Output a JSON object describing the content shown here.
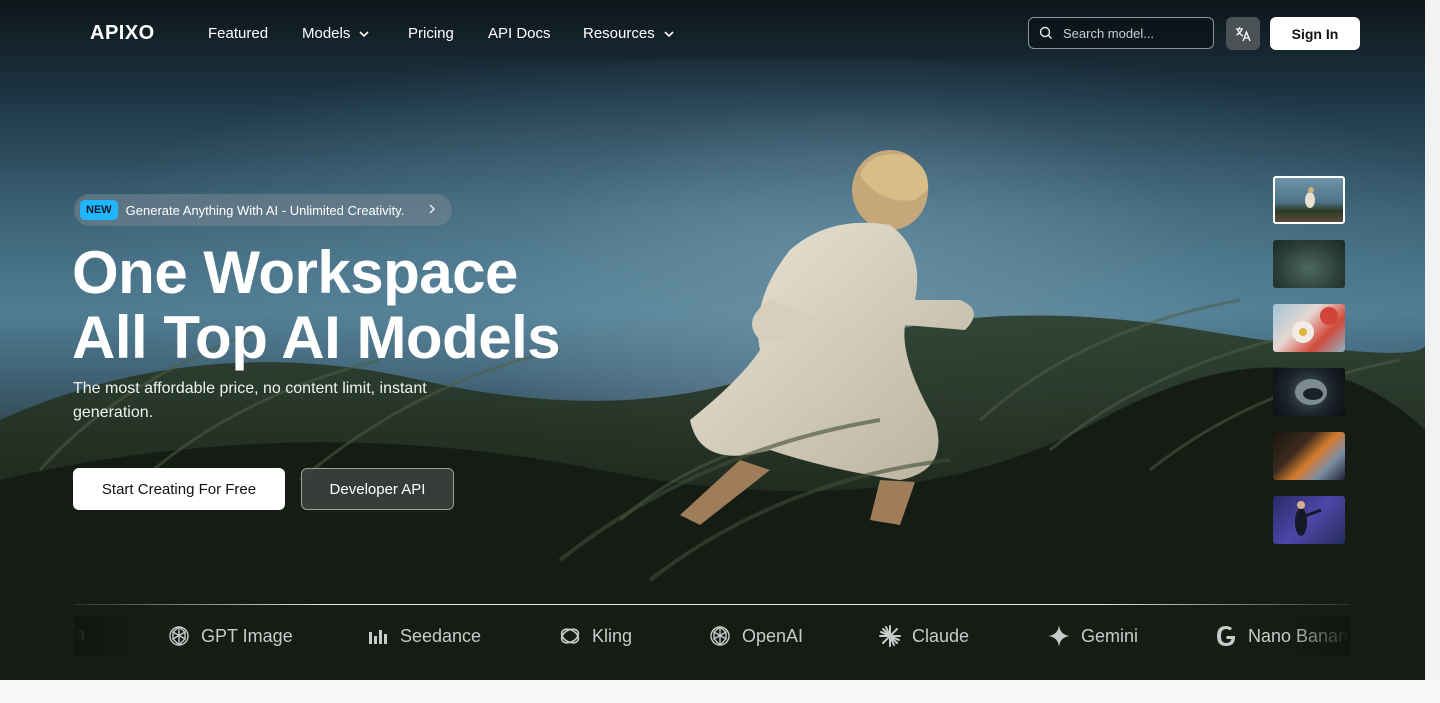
{
  "nav": {
    "logo": "APIXO",
    "items": [
      {
        "label": "Featured",
        "dropdown": false
      },
      {
        "label": "Models",
        "dropdown": true
      },
      {
        "label": "Pricing",
        "dropdown": false
      },
      {
        "label": "API Docs",
        "dropdown": false
      },
      {
        "label": "Resources",
        "dropdown": true
      }
    ],
    "search_placeholder": "Search model...",
    "language_icon": "translate-icon",
    "sign_in": "Sign In"
  },
  "hero": {
    "badge_tag": "NEW",
    "badge_text": "Generate Anything With AI - Unlimited Creativity.",
    "headline_line1": "One Workspace",
    "headline_line2": "All Top AI Models",
    "subtitle": "The most affordable price, no content limit, instant generation.",
    "primary_cta": "Start Creating For Free",
    "secondary_cta": "Developer API"
  },
  "thumbnails": [
    {
      "name": "runner-thumbnail",
      "active": true
    },
    {
      "name": "forest-thumbnail",
      "active": false
    },
    {
      "name": "flowers-thumbnail",
      "active": false
    },
    {
      "name": "helmet-thumbnail",
      "active": false
    },
    {
      "name": "fire-thumbnail",
      "active": false
    },
    {
      "name": "dancer-thumbnail",
      "active": false
    }
  ],
  "brands": [
    {
      "label": "na",
      "icon": "partial-icon"
    },
    {
      "label": "GPT Image",
      "icon": "openai-icon"
    },
    {
      "label": "Seedance",
      "icon": "bars-icon"
    },
    {
      "label": "Kling",
      "icon": "kling-icon"
    },
    {
      "label": "OpenAI",
      "icon": "openai-icon"
    },
    {
      "label": "Claude",
      "icon": "claude-icon"
    },
    {
      "label": "Gemini",
      "icon": "gemini-icon"
    },
    {
      "label": "Nano Banan",
      "icon": "google-icon"
    }
  ],
  "colors": {
    "badge_new": "#1fb6ff",
    "sign_in_bg": "#ffffff",
    "brand_text": "#c7cbcc"
  }
}
